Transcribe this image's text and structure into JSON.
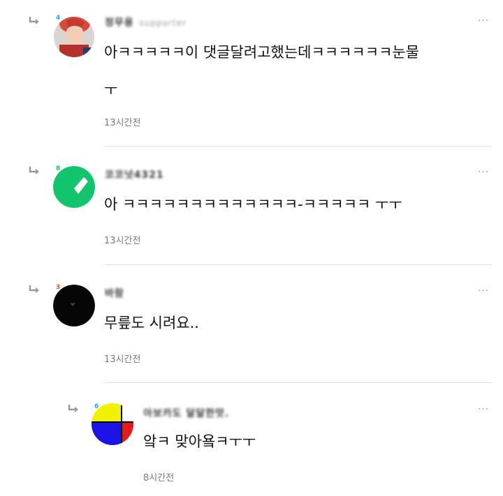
{
  "comments": [
    {
      "badge": "4",
      "badge_color": "#2aa6e0",
      "avatar_icon": "profile-photo",
      "author": "정무용",
      "author_sub": "supporter",
      "text_line1": "아ㅋㅋㅋㅋㅋ이 댓글달려고했는데ㅋㅋㅋㅋㅋㅋ눈물",
      "text_line2": "ㅜ",
      "time": "13시간전"
    },
    {
      "badge": "8",
      "badge_color": "#13c46f",
      "avatar_icon": "green-circle-logo",
      "author": "코코넛4321",
      "text_line1": "아 ㅋㅋㅋㅋㅋㅋㅋㅋㅋㅋㅋㅋㅋ-ㅋㅋㅋㅋㅋ ㅜㅜ",
      "time": "13시간전"
    },
    {
      "badge": "3",
      "badge_color": "#e8512a",
      "avatar_icon": "black-circle-heart",
      "author": "바람",
      "text_line1": "무릎도 시려요..",
      "time": "13시간전"
    },
    {
      "badge": "6",
      "badge_color": "#2aa6e0",
      "avatar_icon": "color-block-avatar",
      "author": "아보카도 달달한맛.",
      "text_line1": "앜ㅋ 맞아욬ㅋㅜㅜ",
      "time": "8시간전"
    }
  ],
  "more_label": "···",
  "colors": {
    "divider": "#e6e6e6",
    "time": "#7a7a7a",
    "arrow": "#9a9a9a"
  }
}
